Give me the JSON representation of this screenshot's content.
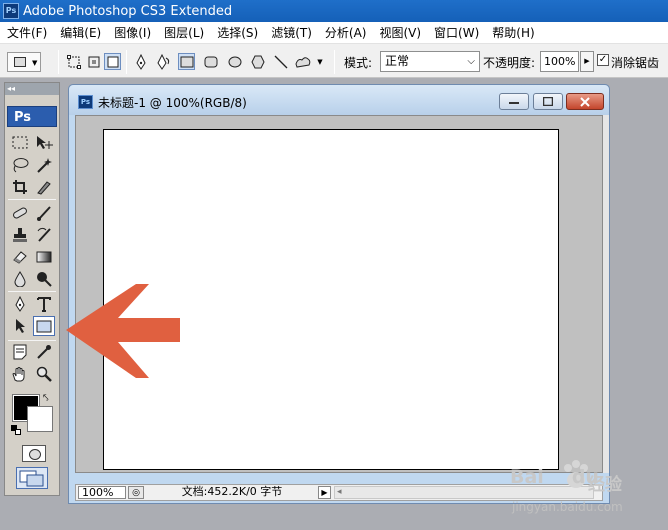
{
  "window": {
    "title": "Adobe Photoshop CS3 Extended",
    "app_icon": "Ps"
  },
  "menu": [
    {
      "label": "文件(F)"
    },
    {
      "label": "编辑(E)"
    },
    {
      "label": "图像(I)"
    },
    {
      "label": "图层(L)"
    },
    {
      "label": "选择(S)"
    },
    {
      "label": "滤镜(T)"
    },
    {
      "label": "分析(A)"
    },
    {
      "label": "视图(V)"
    },
    {
      "label": "窗口(W)"
    },
    {
      "label": "帮助(H)"
    }
  ],
  "options": {
    "mode_label": "模式:",
    "mode_value": "正常",
    "opacity_label": "不透明度:",
    "opacity_value": "100%",
    "antialias_label": "消除锯齿",
    "antialias_checked": true,
    "selected_shape": "rectangle-tool"
  },
  "toolbox": {
    "logo": "Ps",
    "selected_tool": "rectangle-tool",
    "foreground_color": "#000000",
    "background_color": "#ffffff"
  },
  "document": {
    "title": "未标题-1 @ 100%(RGB/8)",
    "icon": "Ps",
    "zoom": "100%",
    "info": "文档:452.2K/0 字节"
  },
  "annotation": {
    "arrow_color": "#e06040"
  },
  "watermark": {
    "brand": "Bai",
    "brand2": "du",
    "product": "经验",
    "url": "jingyan.baidu.com"
  }
}
